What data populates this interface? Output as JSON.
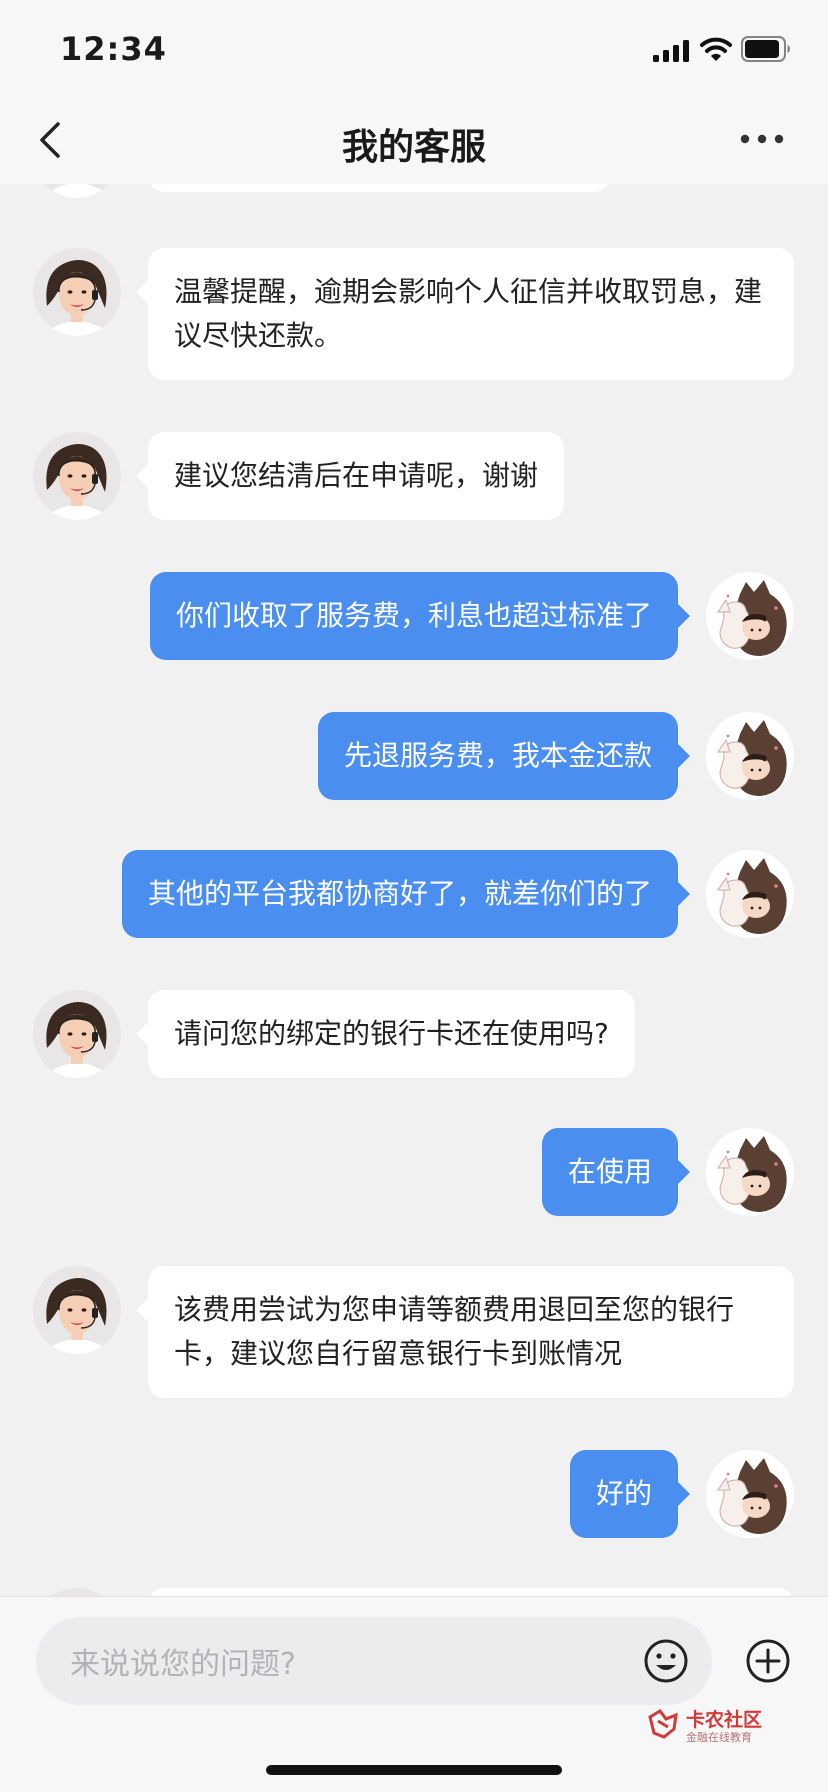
{
  "status_bar": {
    "time": "12:34"
  },
  "header": {
    "title": "我的客服"
  },
  "messages": [
    {
      "sender": "agent",
      "text": ""
    },
    {
      "sender": "agent",
      "text": "温馨提醒，逾期会影响个人征信并收取罚息，建议尽快还款。"
    },
    {
      "sender": "agent",
      "text": "建议您结清后在申请呢，谢谢"
    },
    {
      "sender": "user",
      "text": "你们收取了服务费，利息也超过标准了"
    },
    {
      "sender": "user",
      "text": "先退服务费，我本金还款"
    },
    {
      "sender": "user",
      "text": "其他的平台我都协商好了，就差你们的了"
    },
    {
      "sender": "agent",
      "text": "请问您的绑定的银行卡还在使用吗?"
    },
    {
      "sender": "user",
      "text": "在使用"
    },
    {
      "sender": "agent",
      "text": "该费用尝试为您申请等额费用退回至您的银行卡，建议您自行留意银行卡到账情况"
    },
    {
      "sender": "user",
      "text": "好的"
    }
  ],
  "input": {
    "placeholder": "来说说您的问题?"
  },
  "watermark": {
    "brand": "卡农社区",
    "tagline": "金融在线教育"
  },
  "colors": {
    "user_bubble": "#4a8ef0",
    "agent_bubble": "#ffffff",
    "background": "#f1f1f2"
  },
  "icons": {
    "back": "chevron-left-icon",
    "more": "more-dots-icon",
    "emoji": "smiley-icon",
    "plus": "plus-circle-icon",
    "signal": "cellular-signal-icon",
    "wifi": "wifi-icon",
    "battery": "battery-icon"
  }
}
